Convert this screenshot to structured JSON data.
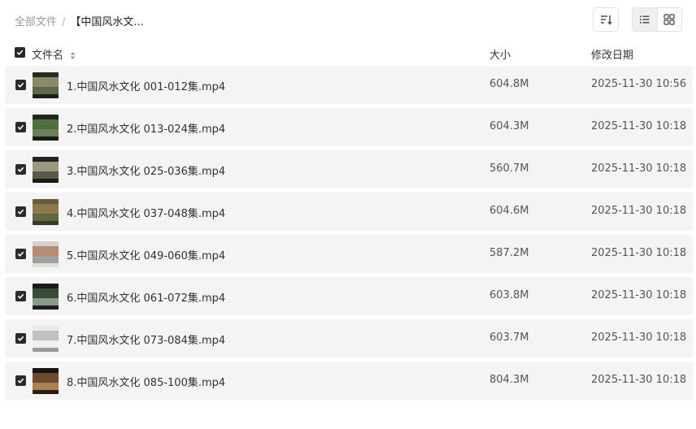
{
  "breadcrumb": {
    "root": "全部文件",
    "separator": "/",
    "current": "【中国风水文..."
  },
  "toolbar": {
    "sort_icon": "sort-icon",
    "list_view_icon": "list-view-icon",
    "grid_view_icon": "grid-view-icon",
    "active_view": "list"
  },
  "columns": {
    "name": "文件名",
    "size": "大小",
    "modified": "修改日期"
  },
  "files": [
    {
      "name": "1.中国风水文化 001-012集.mp4",
      "size": "604.8M",
      "modified": "2025-11-30 10:56",
      "thumb_colors": [
        "#2a2a20",
        "#8a8a6a",
        "#5c6a4a",
        "#1e1e1a"
      ]
    },
    {
      "name": "2.中国风水文化 013-024集.mp4",
      "size": "604.3M",
      "modified": "2025-11-30 10:18",
      "thumb_colors": [
        "#1c2a1c",
        "#4f6f3f",
        "#6b7f5a",
        "#1a1a16"
      ]
    },
    {
      "name": "3.中国风水文化 025-036集.mp4",
      "size": "560.7M",
      "modified": "2025-11-30 10:18",
      "thumb_colors": [
        "#22221e",
        "#9a9a80",
        "#5a5a48",
        "#1a1a18"
      ]
    },
    {
      "name": "4.中国风水文化 037-048集.mp4",
      "size": "604.6M",
      "modified": "2025-11-30 10:18",
      "thumb_colors": [
        "#6a5a3a",
        "#8a7a4a",
        "#5f6a3f",
        "#3a3a2a"
      ]
    },
    {
      "name": "5.中国风水文化 049-060集.mp4",
      "size": "587.2M",
      "modified": "2025-11-30 10:18",
      "thumb_colors": [
        "#d8d0c8",
        "#b88a70",
        "#a0a0a0",
        "#e0e0d8"
      ]
    },
    {
      "name": "6.中国风水文化 061-072集.mp4",
      "size": "603.8M",
      "modified": "2025-11-30 10:18",
      "thumb_colors": [
        "#1a1a1a",
        "#3a4a3a",
        "#8a9a8a",
        "#202020"
      ]
    },
    {
      "name": "7.中国风水文化 073-084集.mp4",
      "size": "603.7M",
      "modified": "2025-11-30 10:18",
      "thumb_colors": [
        "#e8e8e8",
        "#c0c0c0",
        "#f0f0f0",
        "#9a9a9a"
      ]
    },
    {
      "name": "8.中国风水文化 085-100集.mp4",
      "size": "804.3M",
      "modified": "2025-11-30 10:18",
      "thumb_colors": [
        "#1a1410",
        "#6a4a2a",
        "#b08050",
        "#2a1e14"
      ]
    }
  ],
  "colors": {
    "row_background": "#f4f4f4",
    "checkbox": "#2b2b2b",
    "text": "#333333"
  }
}
